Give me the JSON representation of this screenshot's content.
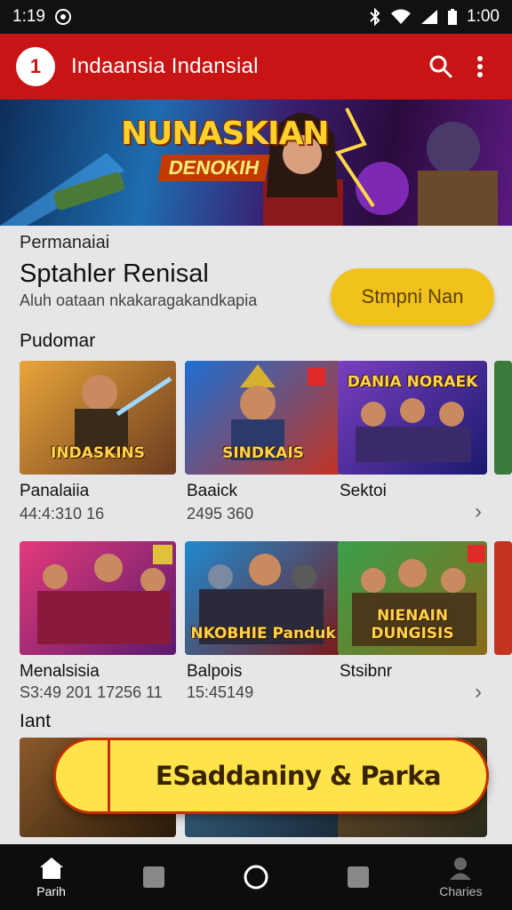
{
  "status_bar": {
    "time": "1:19",
    "right_time": "1:00"
  },
  "app_bar": {
    "title": "Indaansia Indansial",
    "logo_text": "1"
  },
  "banner": {
    "title": "NUNASKIAN",
    "subtitle": "DENOKIH"
  },
  "promo": {
    "eyebrow": "Permanaiai",
    "title": "Sptahler Renisal",
    "description": "Aluh oataan nkakaragakandkapia",
    "button_label": "Stmpni Nan"
  },
  "sections": {
    "first_heading": "Pudomar",
    "last_heading": "Iant"
  },
  "rows": [
    {
      "cards": [
        {
          "art_label": "INDASKINS",
          "title": "Panalaiia",
          "subtitle": "44:4:310 16",
          "colors": [
            "#e9a53a",
            "#6b3b1f"
          ]
        },
        {
          "art_label": "SINDKAIS",
          "title": "Baaick",
          "subtitle": "2495 360",
          "colors": [
            "#1d6fd4",
            "#c43320"
          ]
        },
        {
          "art_label": "DANIA NORAEK",
          "title": "Sektoi",
          "subtitle": "",
          "colors": [
            "#7a3fc0",
            "#1a1a6e"
          ]
        }
      ]
    },
    {
      "cards": [
        {
          "art_label": "",
          "title": "Menalsisia",
          "subtitle": "S3:49 201 17256 11",
          "colors": [
            "#e23a7a",
            "#5a1a6e"
          ]
        },
        {
          "art_label": "NKOBHIE Panduk",
          "title": "Balpois",
          "subtitle": "15:45149",
          "colors": [
            "#1e8ad0",
            "#7a1a1a"
          ]
        },
        {
          "art_label": "NIENAIN DUNGISIS",
          "title": "Stsibnr",
          "subtitle": "",
          "colors": [
            "#3aa04a",
            "#e0c23a"
          ]
        }
      ]
    }
  ],
  "fab": {
    "label": "ESaddaniny & Parka"
  },
  "bottom_nav": [
    {
      "label": "Parih",
      "icon": "home-icon",
      "active": true
    },
    {
      "label": "",
      "icon": "square-icon",
      "active": false
    },
    {
      "label": "",
      "icon": "circle-icon",
      "active": false
    },
    {
      "label": "",
      "icon": "square-icon",
      "active": false
    },
    {
      "label": "Charies",
      "icon": "person-icon",
      "active": false
    }
  ]
}
